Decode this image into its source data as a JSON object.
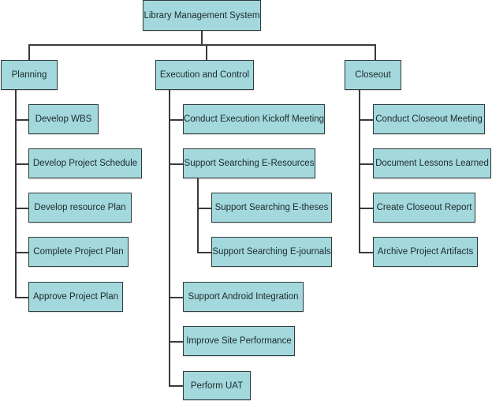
{
  "diagram": {
    "type": "work-breakdown-structure",
    "colors": {
      "node_fill": "#a3d8dc",
      "node_border": "#2f3b3d",
      "connector": "#3a3a3a"
    },
    "root": {
      "label": "Library Management System"
    },
    "phases": [
      {
        "label": "Planning",
        "tasks": [
          {
            "label": "Develop WBS"
          },
          {
            "label": "Develop Project Schedule"
          },
          {
            "label": "Develop resource Plan"
          },
          {
            "label": "Complete Project Plan"
          },
          {
            "label": "Approve Project Plan"
          }
        ]
      },
      {
        "label": "Execution and Control",
        "tasks": [
          {
            "label": "Conduct Execution Kickoff Meeting"
          },
          {
            "label": "Support Searching E-Resources",
            "subtasks": [
              {
                "label": "Support Searching E-theses"
              },
              {
                "label": "Support Searching E-journals"
              }
            ]
          },
          {
            "label": "Support Android Integration"
          },
          {
            "label": "Improve Site Performance"
          },
          {
            "label": "Perform UAT"
          }
        ]
      },
      {
        "label": "Closeout",
        "tasks": [
          {
            "label": "Conduct Closeout Meeting"
          },
          {
            "label": "Document Lessons Learned"
          },
          {
            "label": "Create Closeout Report"
          },
          {
            "label": "Archive Project Artifacts"
          }
        ]
      }
    ]
  }
}
